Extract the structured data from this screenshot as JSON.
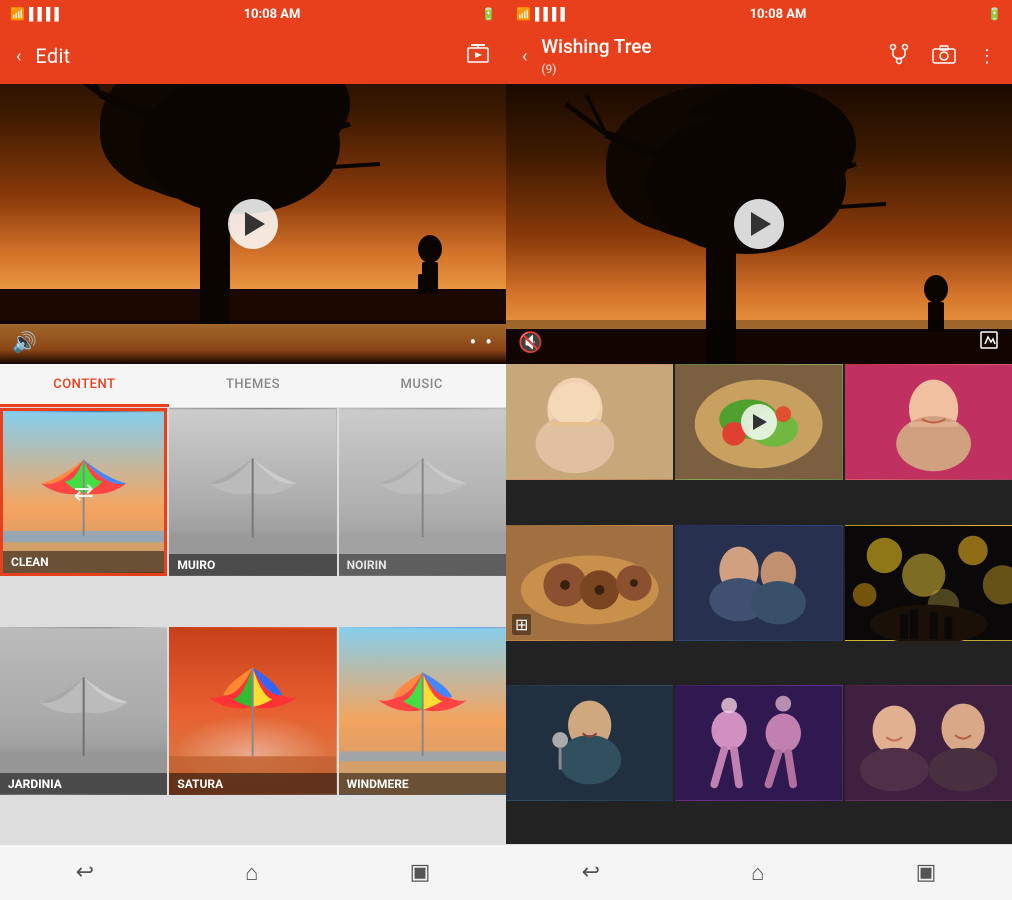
{
  "left": {
    "status": {
      "time": "10:08 AM",
      "wifi": "wifi",
      "signal": "signal",
      "battery": "battery"
    },
    "appbar": {
      "back_label": "Edit",
      "export_icon": "export"
    },
    "video": {
      "sound_icon": "🔊",
      "more_icon": "⋯"
    },
    "tabs": [
      {
        "label": "CONTENT",
        "active": true
      },
      {
        "label": "THEMES",
        "active": false
      },
      {
        "label": "MUSIC",
        "active": false
      }
    ],
    "themes": [
      {
        "id": "clean",
        "label": "CLEAN",
        "selected": true,
        "style": "clean"
      },
      {
        "id": "muiro",
        "label": "MUIRO",
        "selected": false,
        "style": "muiro"
      },
      {
        "id": "noirin",
        "label": "NOIRIN",
        "selected": false,
        "style": "noirin"
      },
      {
        "id": "jardinia",
        "label": "JARDINIA",
        "selected": false,
        "style": "jardinia"
      },
      {
        "id": "satura",
        "label": "SATURA",
        "selected": false,
        "style": "satura"
      },
      {
        "id": "windmere",
        "label": "WINDMERE",
        "selected": false,
        "style": "windmere"
      }
    ],
    "nav": {
      "back": "↩",
      "home": "⌂",
      "recents": "▣"
    }
  },
  "right": {
    "status": {
      "time": "10:08 AM"
    },
    "appbar": {
      "back_icon": "<",
      "title": "Wishing Tree",
      "subtitle": "(9)",
      "fork_icon": "fork",
      "camera_icon": "camera",
      "more_icon": "⋮"
    },
    "video": {
      "mute_icon": "🔇",
      "edit_icon": "✎"
    },
    "photos": [
      {
        "id": 1,
        "type": "person",
        "has_play": false,
        "style": "photo-1"
      },
      {
        "id": 2,
        "type": "salad",
        "has_play": true,
        "style": "photo-2"
      },
      {
        "id": 3,
        "type": "woman",
        "has_play": false,
        "style": "photo-3"
      },
      {
        "id": 4,
        "type": "food",
        "has_play": false,
        "style": "photo-4",
        "has_overlay": true
      },
      {
        "id": 5,
        "type": "couple",
        "has_play": false,
        "style": "photo-5"
      },
      {
        "id": 6,
        "type": "lights",
        "has_play": false,
        "style": "photo-6"
      },
      {
        "id": 7,
        "type": "singer",
        "has_play": false,
        "style": "photo-7"
      },
      {
        "id": 8,
        "type": "dancing",
        "has_play": false,
        "style": "photo-8"
      },
      {
        "id": 9,
        "type": "friends",
        "has_play": false,
        "style": "photo-9"
      }
    ],
    "nav": {
      "back": "↩",
      "home": "⌂",
      "recents": "▣"
    }
  }
}
